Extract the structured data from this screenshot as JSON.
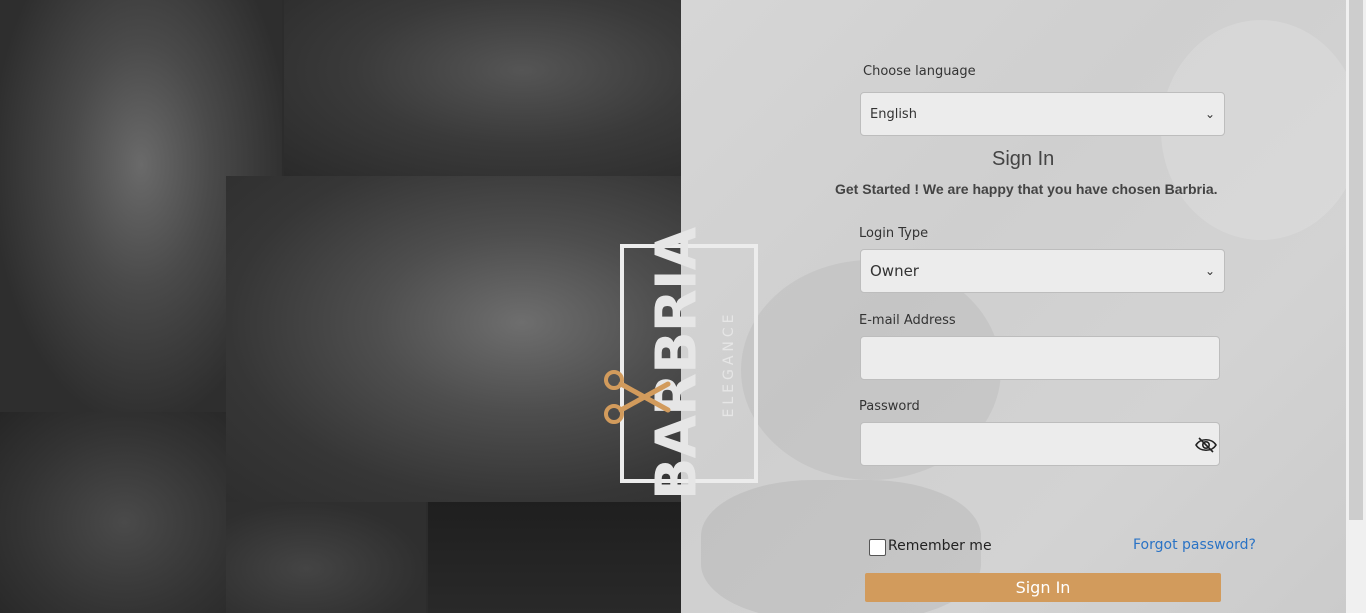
{
  "brand": {
    "logo_main": "BARBRIA",
    "logo_sub": "ELEGANCE"
  },
  "language": {
    "label": "Choose language",
    "selected": "English"
  },
  "heading": {
    "title": "Sign In",
    "subtitle": "Get Started ! We are happy that you have chosen Barbria."
  },
  "login_type": {
    "label": "Login Type",
    "selected": "Owner"
  },
  "email": {
    "label": "E-mail Address",
    "value": ""
  },
  "password": {
    "label": "Password",
    "value": ""
  },
  "remember": {
    "label": "Remember me"
  },
  "forgot": {
    "label": "Forgot password?"
  },
  "submit": {
    "label": "Sign In"
  },
  "icons": {
    "select_chevron": "chevron-down-icon",
    "password_toggle": "eye-slash-icon",
    "logo_mark": "scissors-icon"
  },
  "colors": {
    "accent": "#d29b5c",
    "link": "#2a73c5",
    "left_bg": "#2c2c2c",
    "right_bg": "#d3d3d3"
  }
}
